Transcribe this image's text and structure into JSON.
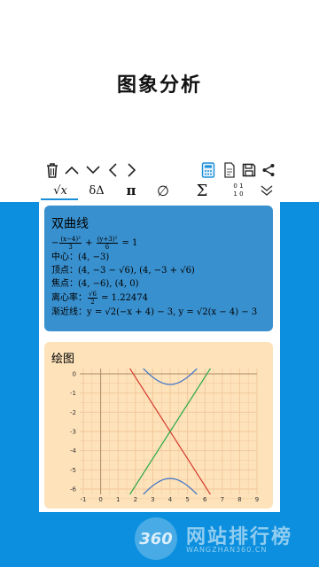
{
  "heading": "图象分析",
  "toolbar": {
    "icons": [
      "trash-icon",
      "chevron-up-icon",
      "chevron-down-icon",
      "chevron-left-icon",
      "chevron-right-icon",
      "calculator-icon",
      "document-icon",
      "save-icon",
      "share-icon"
    ]
  },
  "modes": {
    "sqrt": "√x",
    "delta": "δΔ",
    "pi": "π",
    "empty_set": "∅",
    "sigma": "Σ",
    "matrix_top": "0 1",
    "matrix_bottom": "1 0",
    "more": "more"
  },
  "result": {
    "title": "双曲线",
    "equation_term1_num": "(x−4)²",
    "equation_term1_den": "3",
    "equation_plus": "+",
    "equation_term2_num": "(y+3)²",
    "equation_term2_den": "6",
    "equation_rhs": "= 1",
    "center_label": "中心：",
    "center_value": "(4, −3)",
    "vertices_label": "顶点：",
    "vertices_value": "(4, −3 − √6), (4, −3 + √6)",
    "foci_label": "焦点：",
    "foci_value": "(4, −6), (4, 0)",
    "ecc_label": "离心率：",
    "ecc_num": "√6",
    "ecc_den": "2",
    "ecc_value": "= 1.22474",
    "asym_label": "渐近线：",
    "asym_value": "y = √2(−x + 4) − 3, y = √2(x − 4) − 3"
  },
  "plot": {
    "title": "绘图"
  },
  "chart_data": {
    "type": "line",
    "xlim": [
      -1,
      9
    ],
    "ylim": [
      -6,
      0
    ],
    "x_ticks": [
      -1,
      0,
      1,
      2,
      3,
      4,
      5,
      6,
      7,
      8,
      9
    ],
    "y_ticks": [
      0,
      -1,
      -2,
      -3,
      -4,
      -5,
      -6
    ],
    "series": [
      {
        "color": "#3c73c8",
        "kind": "hyperbola",
        "center": [
          4,
          -3
        ],
        "a2": 6,
        "b2": 3
      },
      {
        "color": "#d43a2f",
        "kind": "line",
        "slope": -1.41421,
        "point": [
          4,
          -3
        ]
      },
      {
        "color": "#27a844",
        "kind": "line",
        "slope": 1.41421,
        "point": [
          4,
          -3
        ]
      }
    ],
    "colors": {
      "grid": "#f2c79a",
      "axis": "#b08c6a",
      "background": "#fde2ba"
    }
  },
  "watermark": {
    "logo": "360",
    "text": "网站排行榜",
    "sub": "WANGZHAN360.CN"
  }
}
